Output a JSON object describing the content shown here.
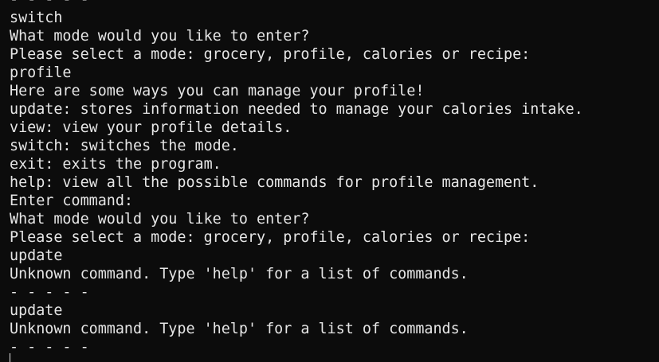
{
  "terminal": {
    "lines": [
      "- - - - -",
      "switch",
      "What mode would you like to enter?",
      "Please select a mode: grocery, profile, calories or recipe:",
      "profile",
      "Here are some ways you can manage your profile!",
      "update: stores information needed to manage your calories intake.",
      "view: view your profile details.",
      "switch: switches the mode.",
      "exit: exits the program.",
      "help: view all the possible commands for profile management.",
      "Enter command:",
      "What mode would you like to enter?",
      "Please select a mode: grocery, profile, calories or recipe:",
      "update",
      "Unknown command. Type 'help' for a list of commands.",
      "- - - - -",
      "update",
      "Unknown command. Type 'help' for a list of commands.",
      "- - - - -"
    ]
  },
  "colors": {
    "background": "#0c0c0c",
    "text": "#e6e6e6"
  }
}
